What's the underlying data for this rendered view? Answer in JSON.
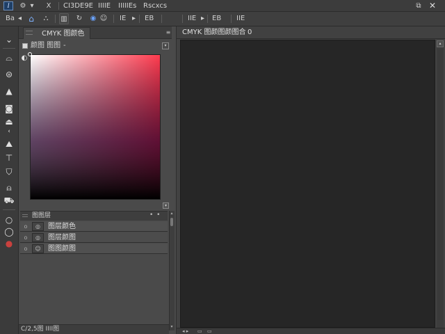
{
  "menubar": {
    "logo_glyph": "I",
    "icons": [
      {
        "name": "gear-icon",
        "glyph": "⚙"
      },
      {
        "name": "close-x-icon",
        "glyph": "X"
      }
    ],
    "items": [
      "CI3DE9E",
      "IIIIE",
      "IIIIIEs",
      "Rscxcs"
    ],
    "restore_glyph": "⧉",
    "close_glyph": "✕"
  },
  "optionsbar": {
    "first_label": "Ba",
    "first_arrow": "◂",
    "buttons": [
      {
        "name": "home-icon",
        "glyph": "⌂"
      },
      {
        "name": "document-icon",
        "glyph": "⛬"
      },
      {
        "name": "layers-icon",
        "glyph": "▥"
      },
      {
        "name": "rotate-icon",
        "glyph": "↻"
      },
      {
        "name": "globe-icon",
        "glyph": "◉"
      },
      {
        "name": "emoji-icon",
        "glyph": "☺"
      }
    ],
    "groups": [
      {
        "label": "IE",
        "arrow": "▸"
      },
      {
        "label": "EB",
        "arrow": ""
      },
      {
        "label": "IIE",
        "arrow": "▸"
      },
      {
        "label": "EB",
        "arrow": ""
      },
      {
        "label": "IIE",
        "arrow": ""
      }
    ]
  },
  "tools": [
    {
      "name": "chevron-down-icon",
      "glyph": "⌄"
    },
    {
      "name": "move-tool-icon",
      "glyph": "⌓"
    },
    {
      "name": "lasso-tool-icon",
      "glyph": "⊜"
    },
    {
      "name": "triangle-tool-icon",
      "glyph": "▲"
    },
    {
      "name": "crop-tool-icon",
      "glyph": "◙"
    },
    {
      "name": "eyedropper-tool-icon",
      "glyph": "⏏"
    },
    {
      "name": "brush-tool-icon",
      "glyph": "⛰"
    },
    {
      "name": "stamp-tool-icon",
      "glyph": "⊤"
    },
    {
      "name": "shield-tool-icon",
      "glyph": "⛉"
    },
    {
      "name": "path-tool-icon",
      "glyph": "⍝"
    },
    {
      "name": "shape-tool-icon",
      "glyph": "⛟"
    },
    {
      "name": "zoom-tool-icon",
      "glyph": "○"
    },
    {
      "name": "hand-tool-icon",
      "glyph": "◯"
    },
    {
      "name": "color-swatch-icon",
      "glyph": "●"
    }
  ],
  "color_panel": {
    "tab_label": "CMYK 图颜色",
    "mode_label": "颜图 图图",
    "mode_arrow": "-",
    "menu_glyph": "≡",
    "button_glyph": "▾",
    "fgbg_glyph": "◐",
    "field_button_glyph": "▾",
    "field_hue": "#ff3b4e"
  },
  "layers_panel": {
    "title": "图图层",
    "menu_dots": "• •",
    "rows": [
      {
        "name": "图层颜色",
        "vis": "o",
        "thumb": "◎"
      },
      {
        "name": "图层颜图",
        "vis": "o",
        "thumb": "◎"
      },
      {
        "name": "图图颜图",
        "vis": "o",
        "thumb": "☺"
      }
    ],
    "scroll_up": "▴",
    "scroll_down": "▾"
  },
  "status_left": {
    "text": "C/2,5图 IIII图"
  },
  "document": {
    "tab_title": "CMYK 图颜图颜图合",
    "tab_close": "0",
    "canvas_color": "#262626",
    "scroll_up": "▴",
    "status_chips": [
      "◂ ▸",
      "▭",
      "▭"
    ]
  }
}
